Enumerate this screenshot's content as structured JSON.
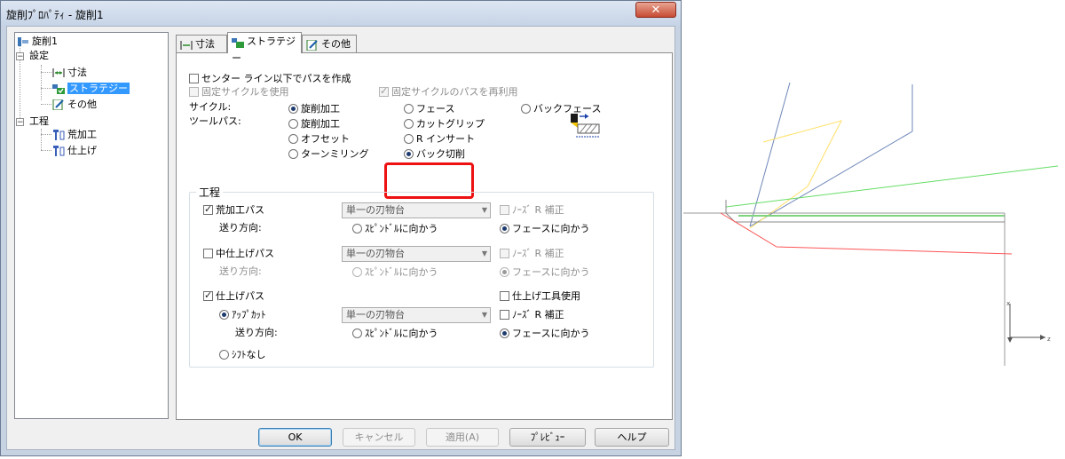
{
  "window": {
    "title": "旋削ﾌﾟﾛﾊﾟﾃｨ - 旋削1",
    "close_label": "✕"
  },
  "tree": {
    "root": "旋削1",
    "settings": "設定",
    "settings_children": [
      "寸法",
      "ストラテジー",
      "その他"
    ],
    "process": "工程",
    "process_children": [
      "荒加工",
      "仕上げ"
    ],
    "selected": "ストラテジー"
  },
  "tabs": [
    "寸法",
    "ストラテジー",
    "その他"
  ],
  "active_tab": "ストラテジー",
  "strategy": {
    "centerline_label": "センター ライン以下でパスを作成",
    "fixed_cycle_label": "固定サイクルを使用",
    "reuse_fixed_cycle_label": "固定サイクルのパスを再利用",
    "cycle_label": "サイクル:",
    "toolpath_label": "ツールパス:",
    "cycle_options": [
      "旋削加工",
      "フェース",
      "バックフェース"
    ],
    "toolpath_options": [
      "旋削加工",
      "カットグリップ",
      "オフセット",
      "R インサート",
      "ターンミリング",
      "バック切削"
    ]
  },
  "process_group": {
    "title": "工程",
    "rough_label": "荒加工パス",
    "semi_label": "中仕上げパス",
    "finish_label": "仕上げパス",
    "feed_dir_label": "送り方向:",
    "turret_value": "単一の刃物台",
    "toward_spindle": "ｽﾋﾟﾝﾄﾞﾙに向かう",
    "toward_face": "フェースに向かう",
    "nose_r_label": "ﾉｰｽﾞ R 補正",
    "finish_tool_label": "仕上げ工具使用",
    "upcut_label": "ｱｯﾌﾟｶｯﾄ",
    "no_shift_label": "ｼﾌﾄなし"
  },
  "buttons": {
    "ok": "OK",
    "cancel": "キャンセル",
    "apply": "適用(A)",
    "preview": "ﾌﾟﾚﾋﾞｭｰ",
    "help": "ヘルプ"
  },
  "axis_labels": {
    "x": "x",
    "z": "z"
  },
  "colors": {
    "highlight": "#ee1111",
    "selection": "#3399ff",
    "rough_path": "#ffe066",
    "tool": "#6e86b8"
  }
}
